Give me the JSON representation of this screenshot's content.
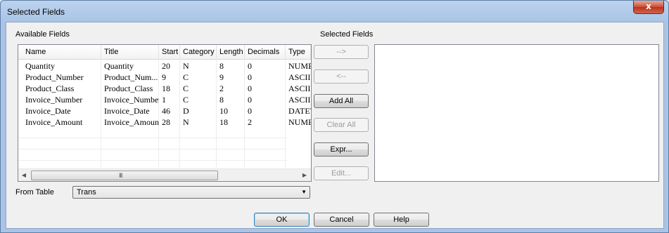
{
  "window": {
    "title": "Selected Fields",
    "close_glyph": "x"
  },
  "available": {
    "label": "Available Fields",
    "columns": [
      "Name",
      "Title",
      "Start",
      "Category",
      "Length",
      "Decimals",
      "Type"
    ],
    "rows": [
      [
        "Quantity",
        "Quantity",
        "20",
        "N",
        "8",
        "0",
        "NUME"
      ],
      [
        "Product_Number",
        "Product_Num...",
        "9",
        "C",
        "9",
        "0",
        "ASCII"
      ],
      [
        "Product_Class",
        "Product_Class",
        "18",
        "C",
        "2",
        "0",
        "ASCII"
      ],
      [
        "Invoice_Number",
        "Invoice_Number",
        "1",
        "C",
        "8",
        "0",
        "ASCII"
      ],
      [
        "Invoice_Date",
        "Invoice_Date",
        "46",
        "D",
        "10",
        "0",
        "DATET"
      ],
      [
        "Invoice_Amount",
        "Invoice_Amount",
        "28",
        "N",
        "18",
        "2",
        "NUME"
      ]
    ],
    "scroll_left_glyph": "◀",
    "scroll_right_glyph": "▶",
    "scroll_grip": "III"
  },
  "selected": {
    "label": "Selected Fields"
  },
  "buttons": {
    "add": "-->",
    "remove": "<--",
    "add_all": "Add All",
    "clear_all": "Clear All",
    "expr": "Expr...",
    "edit": "Edit..."
  },
  "from_table": {
    "label": "From Table",
    "value": "Trans",
    "arrow_glyph": "▼"
  },
  "footer": {
    "ok": "OK",
    "cancel": "Cancel",
    "help": "Help"
  },
  "icons": [
    "close-icon",
    "scroll-left-icon",
    "scroll-right-icon",
    "dropdown-arrow-icon"
  ],
  "colors": {
    "title_bar": "#a9c4e6",
    "close_button": "#cc4d34",
    "dialog_bg": "#f0f0f0",
    "default_button_border": "#3c7fb1"
  }
}
